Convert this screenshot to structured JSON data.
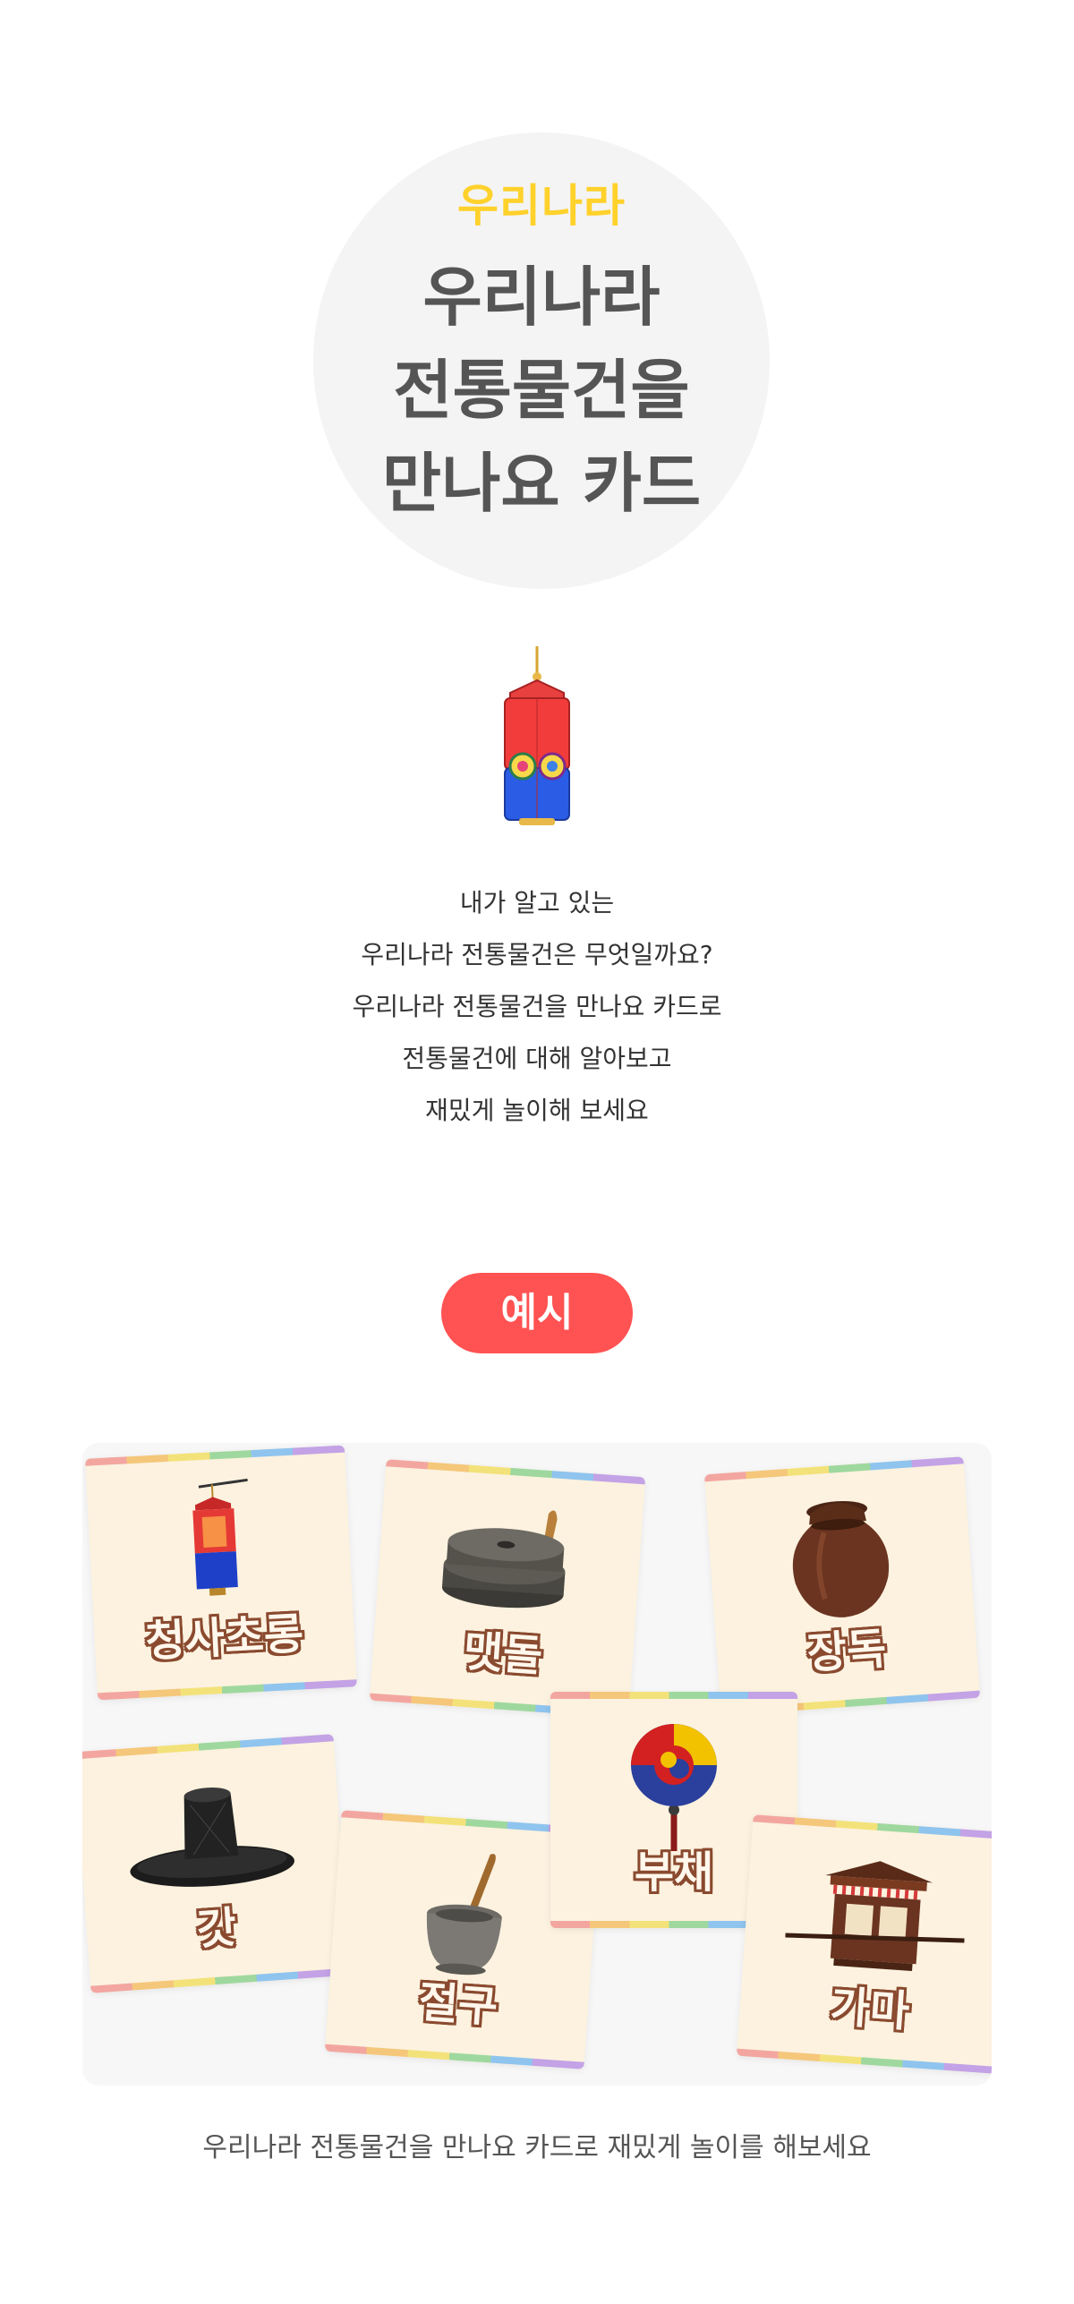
{
  "hero": {
    "subtitle": "우리나라",
    "title_lines": [
      "우리나라",
      "전통물건을",
      "만나요 카드"
    ]
  },
  "intro_lines": [
    "내가 알고 있는",
    "우리나라 전통물건은 무엇일까요?",
    "우리나라 전통물건을 만나요 카드로",
    "전통물건에 대해 알아보고",
    "재밌게 놀이해 보세요"
  ],
  "example_badge": "예시",
  "cards": [
    {
      "label": "청사초롱",
      "icon": "cheongsa-chorong-lantern-icon"
    },
    {
      "label": "맷돌",
      "icon": "millstone-icon"
    },
    {
      "label": "장독",
      "icon": "jangdok-jar-icon"
    },
    {
      "label": "부채",
      "icon": "taegeuk-fan-icon"
    },
    {
      "label": "갓",
      "icon": "gat-hat-icon"
    },
    {
      "label": "절구",
      "icon": "mortar-pestle-icon"
    },
    {
      "label": "가마",
      "icon": "gama-palanquin-icon"
    }
  ],
  "caption": "우리나라 전통물건을 만나요 카드로 재밌게 놀이를 해보세요",
  "colors": {
    "accent_yellow": "#ffd12b",
    "badge_red": "#ff5252",
    "card_bg": "#fcf2df",
    "label_outline": "#8a4a2f"
  }
}
